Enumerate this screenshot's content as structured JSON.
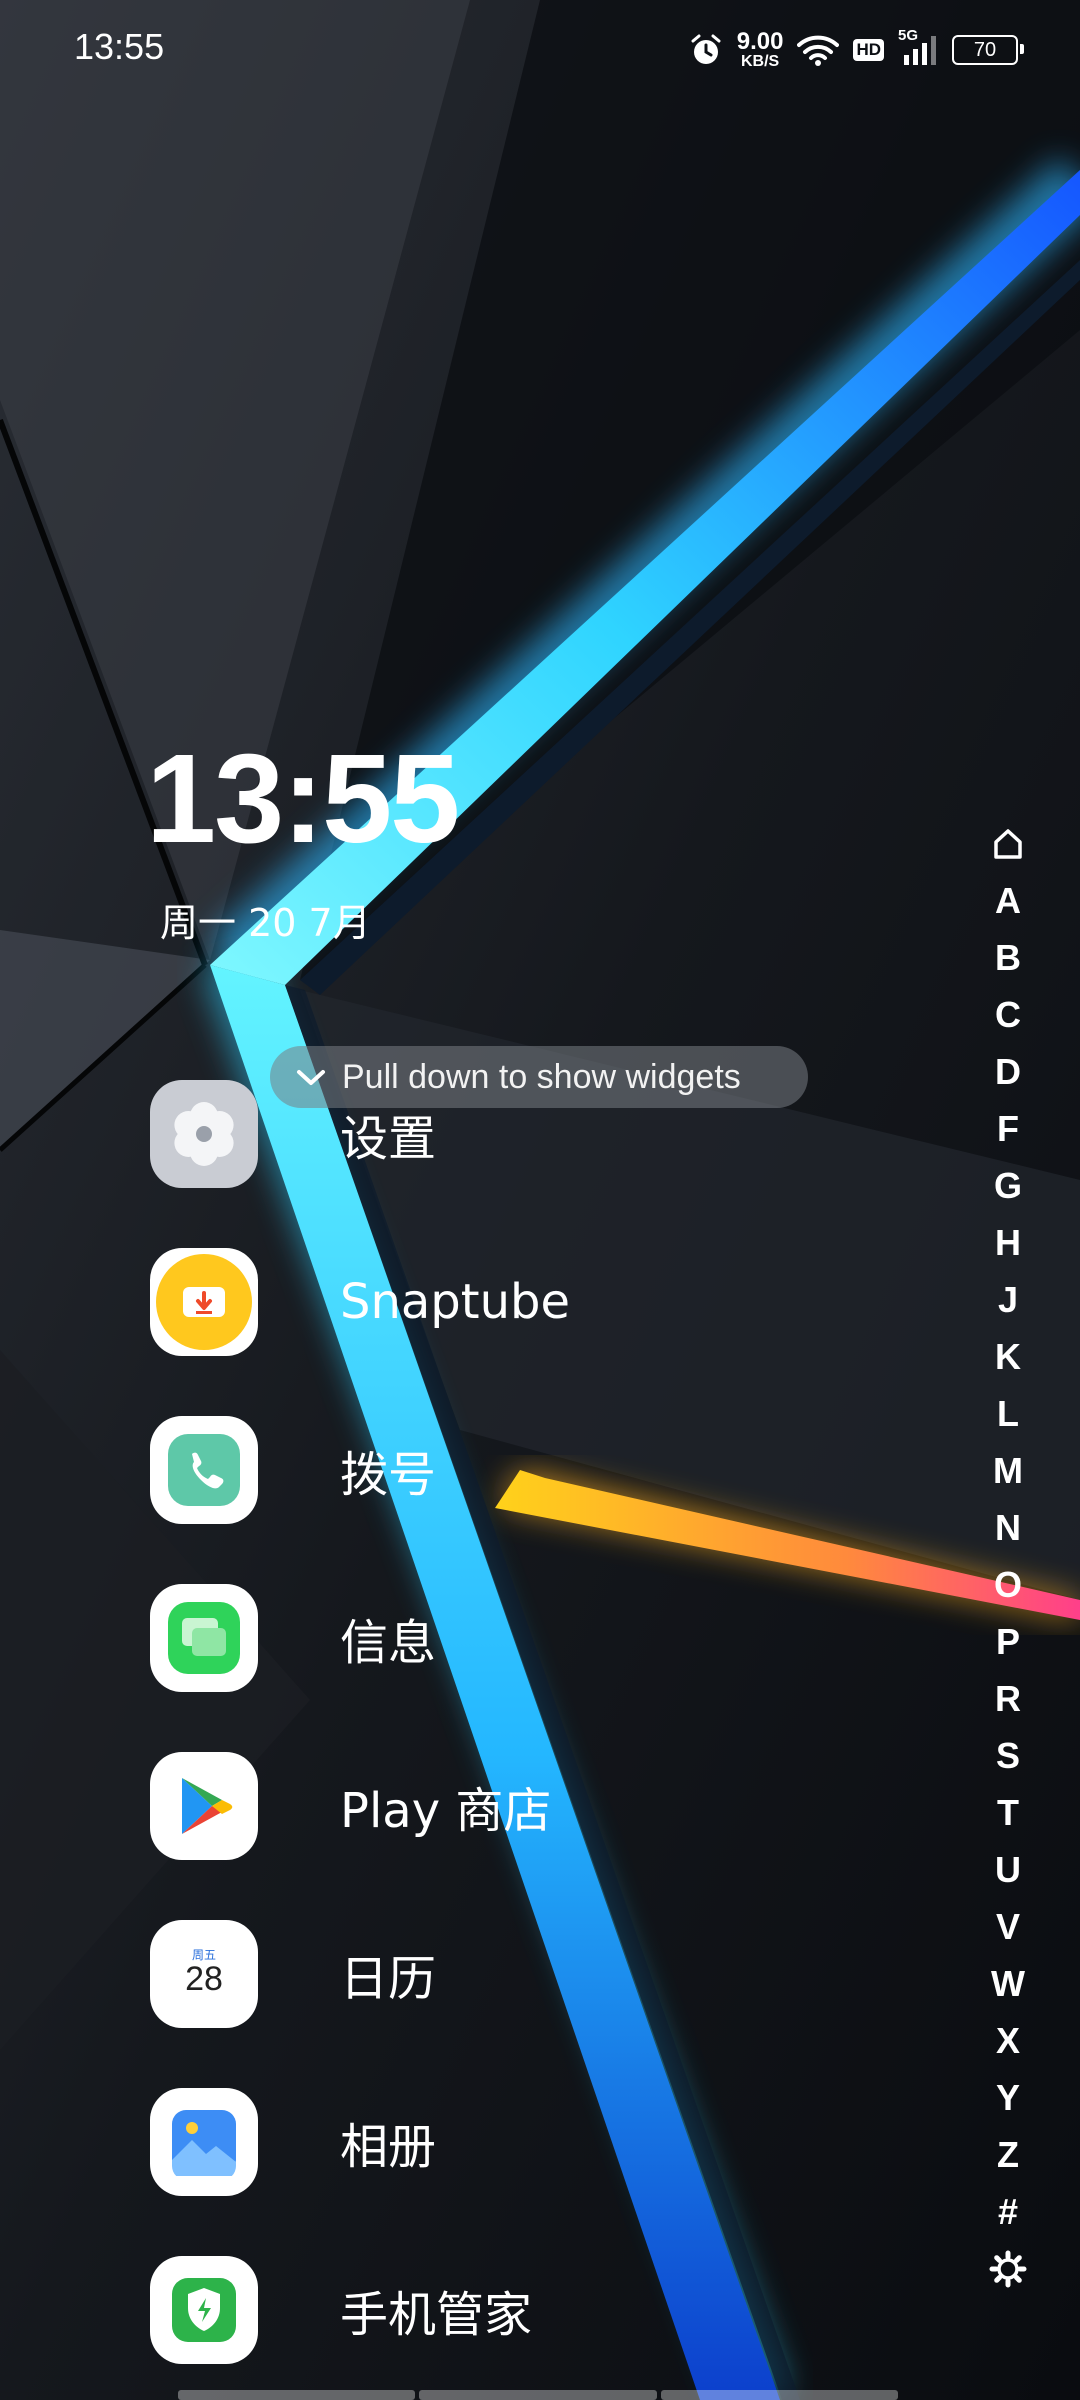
{
  "status_bar": {
    "time": "13:55",
    "net_speed_value": "9.00",
    "net_speed_unit": "KB/S",
    "hd_label": "HD",
    "network_label": "5G",
    "battery_level": "70",
    "icons": [
      "alarm-icon",
      "wifi-icon",
      "hd-icon",
      "signal-icon",
      "battery-icon"
    ]
  },
  "clock": {
    "time": "13:55",
    "date": "周一 20 7月"
  },
  "widget_hint": {
    "text": "Pull down to show widgets"
  },
  "apps": [
    {
      "label": "设置",
      "icon": "settings-icon"
    },
    {
      "label": "Snaptube",
      "icon": "snaptube-icon"
    },
    {
      "label": "拨号",
      "icon": "phone-icon"
    },
    {
      "label": "信息",
      "icon": "messages-icon"
    },
    {
      "label": "Play 商店",
      "icon": "play-store-icon"
    },
    {
      "label": "日历",
      "icon": "calendar-icon",
      "icon_weekday": "周五",
      "icon_day": "28"
    },
    {
      "label": "相册",
      "icon": "gallery-icon"
    },
    {
      "label": "手机管家",
      "icon": "phone-manager-icon"
    }
  ],
  "alpha_index": {
    "top_icon": "home-icon",
    "letters": [
      "A",
      "B",
      "C",
      "D",
      "F",
      "G",
      "H",
      "J",
      "K",
      "L",
      "M",
      "N",
      "O",
      "P",
      "R",
      "S",
      "T",
      "U",
      "V",
      "W",
      "X",
      "Y",
      "Z",
      "#"
    ],
    "bottom_icon": "settings-gear-icon"
  },
  "colors": {
    "accent_blue": "#1f7bff",
    "accent_cyan": "#3ff0ff",
    "accent_yellow": "#ffc21a"
  }
}
